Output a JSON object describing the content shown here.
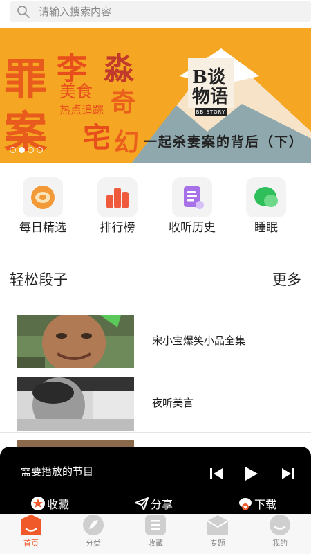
{
  "search": {
    "placeholder": "请输入搜索内容"
  },
  "banner": {
    "caption": "一起杀妻案的背后（下）",
    "logo_label": "BB STORY",
    "logo_text": "B谈物语",
    "art_text": [
      "罪案",
      "李淼",
      "美食",
      "热点追踪",
      "宅",
      "奇幻"
    ],
    "dots_count": 4,
    "active_dot": 1
  },
  "quick_nav": [
    {
      "label": "每日精选",
      "icon": "daily-pick-icon"
    },
    {
      "label": "排行榜",
      "icon": "ranking-icon"
    },
    {
      "label": "收听历史",
      "icon": "history-icon"
    },
    {
      "label": "睡眠",
      "icon": "sleep-icon"
    }
  ],
  "section": {
    "title": "轻松段子",
    "more": "更多"
  },
  "list": [
    {
      "title": "宋小宝爆笑小品全集"
    },
    {
      "title": "夜听美言"
    }
  ],
  "player": {
    "title": "需要播放的节目",
    "actions": {
      "favorite": "收藏",
      "share": "分享",
      "download": "下载"
    }
  },
  "tabs": [
    {
      "label": "首页",
      "icon": "home-icon",
      "active": true
    },
    {
      "label": "分类",
      "icon": "category-icon",
      "active": false
    },
    {
      "label": "收藏",
      "icon": "collection-icon",
      "active": false
    },
    {
      "label": "专题",
      "icon": "topic-icon",
      "active": false
    },
    {
      "label": "我的",
      "icon": "profile-icon",
      "active": false
    }
  ],
  "colors": {
    "accent": "#f0592a",
    "banner_bg": "#f5a623",
    "player_bg": "#000000",
    "tab_inactive": "#c8c8c8"
  }
}
